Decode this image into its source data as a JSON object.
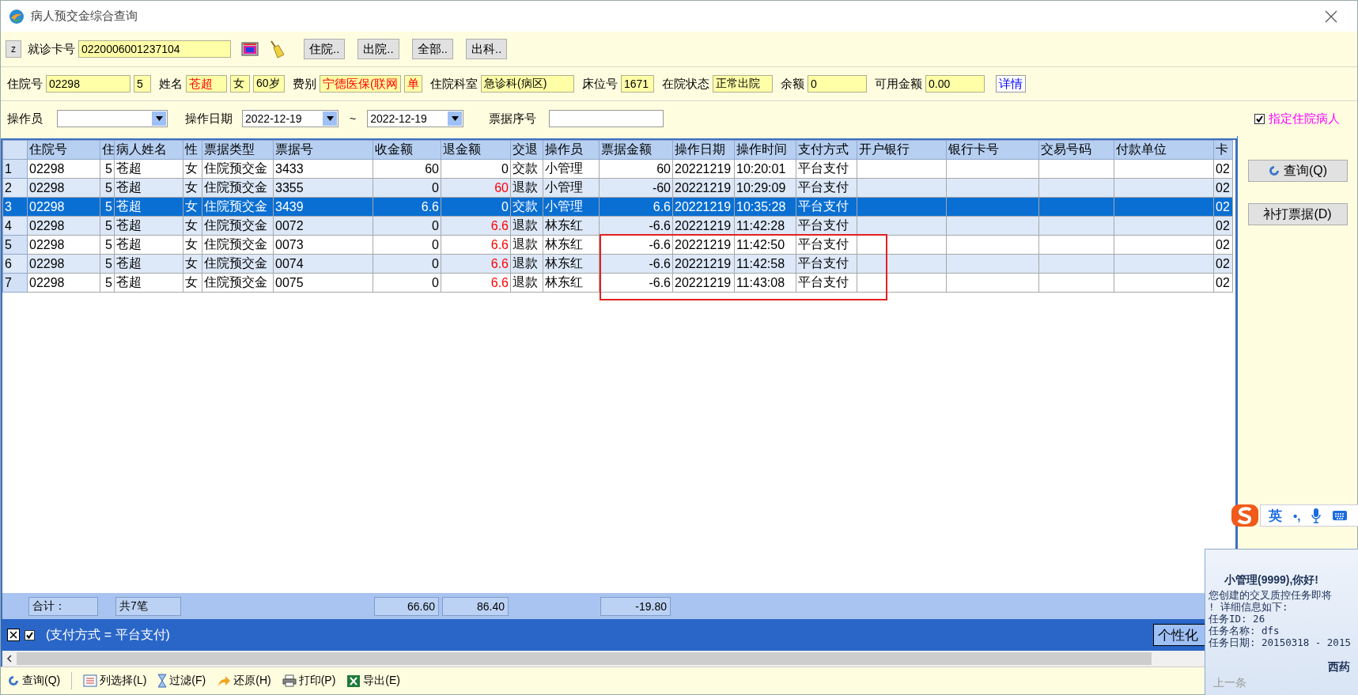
{
  "window": {
    "title": "病人预交金综合查询"
  },
  "card_row": {
    "mode_button": "z",
    "label": "就诊卡号",
    "value": "0220006001237104",
    "buttons": [
      "住院..",
      "出院..",
      "全部..",
      "出科.."
    ]
  },
  "patient": {
    "fields": [
      {
        "label": "住院号",
        "value": "02298",
        "highlight": false
      },
      {
        "value": "5",
        "highlight": false
      },
      {
        "label": "姓名",
        "value": "苍超",
        "highlight": true
      },
      {
        "value": "女",
        "highlight": false
      },
      {
        "value": "60岁",
        "highlight": false
      },
      {
        "label": "费别",
        "value": "宁德医保(联网",
        "highlight": true
      },
      {
        "value": "单",
        "highlight": true
      },
      {
        "label": "住院科室",
        "value": "急诊科(病区)",
        "highlight": false
      },
      {
        "label": "床位号",
        "value": "1671",
        "highlight": false
      },
      {
        "label": "在院状态",
        "value": "正常出院",
        "highlight": false
      },
      {
        "label": "余额",
        "value": "0",
        "highlight": false
      },
      {
        "label": "可用金额",
        "value": "0.00",
        "highlight": false
      }
    ],
    "link": "详情"
  },
  "filters": {
    "operator": {
      "label": "操作员"
    },
    "date": {
      "label": "操作日期",
      "from": "2022-12-19",
      "separator": "~",
      "to": "2022-12-19"
    },
    "receipt_no": {
      "label": "票据序号"
    },
    "inpatient_only": {
      "label": "指定住院病人",
      "checked": true
    }
  },
  "table": {
    "columns": [
      {
        "label": "住院号",
        "kind": "text",
        "total": "合计："
      },
      {
        "label": "住",
        "kind": "number"
      },
      {
        "label": "病人姓名",
        "kind": "text",
        "total": "共7笔"
      },
      {
        "label": "性",
        "kind": "text"
      },
      {
        "label": "票据类型",
        "kind": "text"
      },
      {
        "label": "票据号",
        "kind": "text"
      },
      {
        "label": "收金额",
        "kind": "number",
        "total": "66.60"
      },
      {
        "label": "退金额",
        "kind": "number",
        "total": "86.40"
      },
      {
        "label": "交退",
        "kind": "text"
      },
      {
        "label": "操作员",
        "kind": "text"
      },
      {
        "label": "票据金额",
        "kind": "number",
        "total": "-19.80"
      },
      {
        "label": "操作日期",
        "kind": "text"
      },
      {
        "label": "操作时间",
        "kind": "text"
      },
      {
        "label": "支付方式",
        "kind": "text"
      },
      {
        "label": "开户银行",
        "kind": "text"
      },
      {
        "label": "银行卡号",
        "kind": "text"
      },
      {
        "label": "交易号码",
        "kind": "text"
      },
      {
        "label": "付款单位",
        "kind": "text"
      },
      {
        "label": "卡",
        "kind": "text"
      }
    ],
    "rows": [
      {
        "number": "1",
        "selected": false,
        "kind": "payment",
        "boxed": false,
        "cells": [
          "02298",
          "5",
          "苍超",
          "女",
          "住院预交金",
          "3433",
          "60",
          "0",
          "交款",
          "小管理",
          "60",
          "20221219",
          "10:20:01",
          "平台支付",
          null,
          null,
          null,
          null,
          "02"
        ]
      },
      {
        "number": "2",
        "selected": false,
        "kind": "refund",
        "boxed": false,
        "cells": [
          "02298",
          "5",
          "苍超",
          "女",
          "住院预交金",
          "3355",
          "0",
          "60",
          "退款",
          "小管理",
          "-60",
          "20221219",
          "10:29:09",
          "平台支付",
          null,
          null,
          null,
          null,
          "02"
        ]
      },
      {
        "number": "3",
        "selected": true,
        "kind": "payment",
        "boxed": false,
        "cells": [
          "02298",
          "5",
          "苍超",
          "女",
          "住院预交金",
          "3439",
          "6.6",
          "0",
          "交款",
          "小管理",
          "6.6",
          "20221219",
          "10:35:28",
          "平台支付",
          null,
          null,
          null,
          null,
          "02"
        ]
      },
      {
        "number": "4",
        "selected": false,
        "kind": "refund",
        "boxed": false,
        "cells": [
          "02298",
          "5",
          "苍超",
          "女",
          "住院预交金",
          "0072",
          "0",
          "6.6",
          "退款",
          "林东红",
          "-6.6",
          "20221219",
          "11:42:28",
          "平台支付",
          null,
          null,
          null,
          null,
          "02"
        ]
      },
      {
        "number": "5",
        "selected": false,
        "kind": "refund",
        "boxed": true,
        "cells": [
          "02298",
          "5",
          "苍超",
          "女",
          "住院预交金",
          "0073",
          "0",
          "6.6",
          "退款",
          "林东红",
          "-6.6",
          "20221219",
          "11:42:50",
          "平台支付",
          null,
          null,
          null,
          null,
          "02"
        ]
      },
      {
        "number": "6",
        "selected": false,
        "kind": "refund",
        "boxed": true,
        "cells": [
          "02298",
          "5",
          "苍超",
          "女",
          "住院预交金",
          "0074",
          "0",
          "6.6",
          "退款",
          "林东红",
          "-6.6",
          "20221219",
          "11:42:58",
          "平台支付",
          null,
          null,
          null,
          null,
          "02"
        ]
      },
      {
        "number": "7",
        "selected": false,
        "kind": "refund",
        "boxed": true,
        "cells": [
          "02298",
          "5",
          "苍超",
          "女",
          "住院预交金",
          "0075",
          "0",
          "6.6",
          "退款",
          "林东红",
          "-6.6",
          "20221219",
          "11:43:08",
          "平台支付",
          null,
          null,
          null,
          null,
          "02"
        ]
      }
    ]
  },
  "side_buttons": [
    "查询(Q)",
    "补打票据(D)"
  ],
  "filter_bar": {
    "enabled": true,
    "expression": "(支付方式 = 平台支付)",
    "button": "个性化"
  },
  "toolbar": [
    {
      "label": "查询(Q)",
      "kind": "refresh"
    },
    {
      "label": "列选择(L)",
      "kind": "columns"
    },
    {
      "label": "过滤(F)",
      "kind": "filter"
    },
    {
      "label": "还原(H)",
      "kind": "undo"
    },
    {
      "label": "打印(P)",
      "kind": "print"
    },
    {
      "label": "导出(E)",
      "kind": "excel"
    }
  ],
  "ime_bar": {
    "mode": "英",
    "punctuation": "•,"
  },
  "notification": {
    "greeting": "小管理(9999),你好!",
    "lines": [
      "您创建的交叉质控任务即将",
      "! 详细信息如下:",
      "任务ID: 26",
      "任务名称:  dfs",
      "任务日期: 20150318 - 2015"
    ],
    "sender": "西药",
    "previous": "上一条"
  }
}
